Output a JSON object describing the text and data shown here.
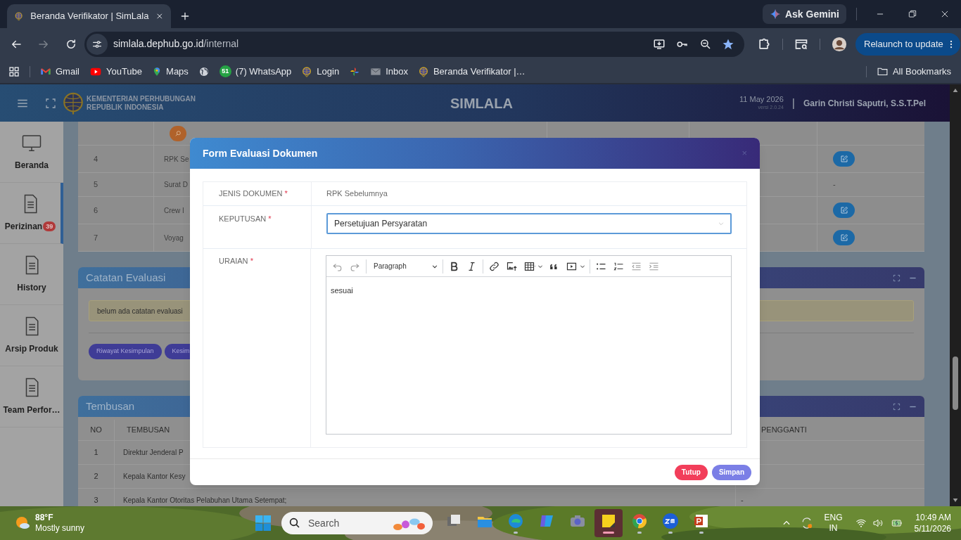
{
  "browser": {
    "tab": {
      "title": "Beranda Verifikator | SimLala"
    },
    "address": {
      "host": "simlala.dephub.go.id",
      "path": "/internal"
    },
    "ask_gemini": "Ask Gemini",
    "relaunch": "Relaunch to update",
    "bookmarks": [
      {
        "kind": "link",
        "label": "Gmail"
      },
      {
        "kind": "link",
        "label": "YouTube"
      },
      {
        "kind": "link",
        "label": "Maps"
      },
      {
        "kind": "icon_only"
      },
      {
        "kind": "link",
        "badge": "51",
        "label": "(7) WhatsApp"
      },
      {
        "kind": "link",
        "label": "Login"
      },
      {
        "kind": "icon_only"
      },
      {
        "kind": "link",
        "label": "Inbox"
      },
      {
        "kind": "link",
        "label": "Beranda Verifikator |…"
      }
    ],
    "all_bookmarks": "All Bookmarks"
  },
  "header": {
    "org_line_1": "KEMENTERIAN PERHUBUNGAN",
    "org_line_2": "REPUBLIK INDONESIA",
    "app_title": "SIMLALA",
    "date": "11 May 2026",
    "version": "versi 2.0.24",
    "separator": "|",
    "user": "Garin Christi Saputri, S.S.T.Pel"
  },
  "sidebar": {
    "items": [
      {
        "label": "Beranda",
        "selected": false
      },
      {
        "label": "Perizinan",
        "badge": "39",
        "selected": true
      },
      {
        "label": "History",
        "selected": false
      },
      {
        "label": "Arsip Produk",
        "selected": false
      },
      {
        "label": "Team Perfor…",
        "selected": false
      }
    ]
  },
  "documents_table": {
    "rows": [
      {
        "kind": "search"
      },
      {
        "kind": "edit",
        "no": "4",
        "name": "RPK Se"
      },
      {
        "kind": "text",
        "no": "5",
        "name": "Surat D",
        "action_text": "-"
      },
      {
        "kind": "edit",
        "no": "6",
        "name": "Crew I"
      },
      {
        "kind": "edit",
        "no": "7",
        "name": "Voyag"
      }
    ]
  },
  "catatan_evaluasi": {
    "title": "Catatan Evaluasi",
    "notice": "belum ada catatan evaluasi",
    "buttons": [
      "Riwayat Kesimpulan",
      "Kesim"
    ]
  },
  "tembusan": {
    "title": "Tembusan",
    "columns": [
      "NO",
      "TEMBUSAN",
      "PENGGANTI"
    ],
    "rows": [
      {
        "no": "1",
        "tembusan": "Direktur Jenderal P"
      },
      {
        "no": "2",
        "tembusan": "Kepala Kantor Kesy"
      },
      {
        "no": "3",
        "tembusan": "Kepala Kantor Otoritas Pelabuhan Utama Setempat;",
        "pengganti": "-"
      }
    ]
  },
  "modal": {
    "title": "Form Evaluasi Dokumen",
    "close": "×",
    "fields": [
      {
        "kind": "static",
        "label": "JENIS DOKUMEN",
        "required_mark": "*",
        "value": "RPK Sebelumnya"
      },
      {
        "kind": "select",
        "label": "KEPUTUSAN",
        "required_mark": "*",
        "value": "Persetujuan Persyaratan"
      },
      {
        "kind": "editor",
        "label": "URAIAN",
        "required_mark": "*",
        "block_style": "Paragraph",
        "value": "sesuai"
      }
    ],
    "buttons": [
      {
        "kind": "close",
        "label": "Tutup"
      },
      {
        "kind": "save",
        "label": "Simpan"
      }
    ]
  },
  "taskbar": {
    "weather": {
      "temp": "88°F",
      "condition": "Mostly sunny"
    },
    "search_placeholder": "Search",
    "apps": [
      {
        "kind": "taskview",
        "running": false,
        "active": false
      },
      {
        "kind": "explorer",
        "running": false,
        "active": false
      },
      {
        "kind": "edge",
        "running": true,
        "active": false
      },
      {
        "kind": "copilot",
        "running": false,
        "active": false
      },
      {
        "kind": "camera",
        "running": false,
        "active": false
      },
      {
        "kind": "sticky",
        "running": true,
        "active": true
      },
      {
        "kind": "chrome",
        "running": true,
        "active": false
      },
      {
        "kind": "zoom",
        "running": true,
        "active": false
      },
      {
        "kind": "powerpoint",
        "running": true,
        "active": false
      }
    ],
    "language": {
      "line_1": "ENG",
      "line_2": "IN"
    },
    "time": "10:49 AM",
    "date": "5/11/2026"
  }
}
